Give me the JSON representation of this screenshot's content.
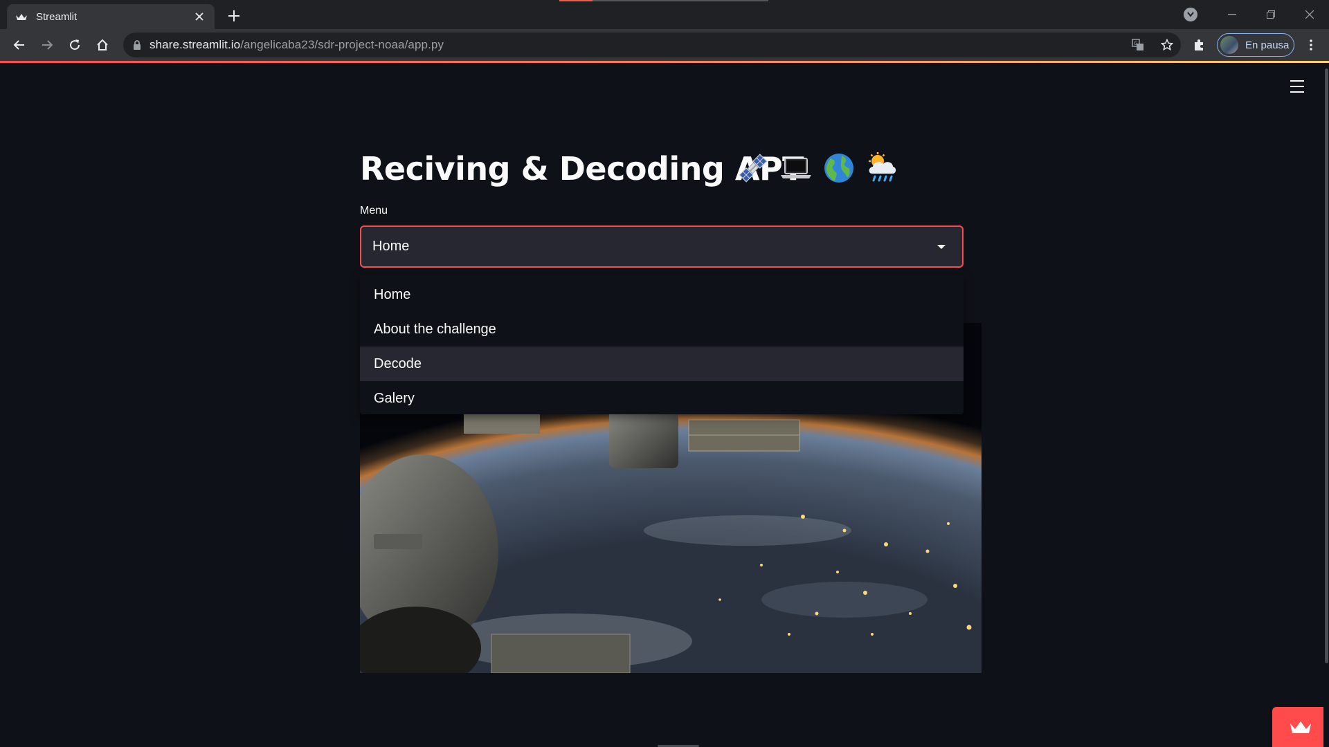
{
  "browser": {
    "tab_title": "Streamlit",
    "url_host": "share.streamlit.io",
    "url_path": "/angelicaba23/sdr-project-noaa/app.py",
    "profile_label": "En pausa",
    "load_progress": 0.16,
    "icons": [
      "streamlit-favicon-icon",
      "close-icon",
      "plus-icon",
      "back-icon",
      "forward-icon",
      "reload-icon",
      "home-icon",
      "lock-icon",
      "translate-icon",
      "star-icon",
      "extensions-icon",
      "kebab-icon",
      "tab-search-icon",
      "minimize-icon",
      "restore-icon",
      "window-close-icon"
    ]
  },
  "app": {
    "title": "Reciving & Decoding APT",
    "title_emojis": [
      "satellite-emoji",
      "laptop-emoji",
      "globe-emoji",
      "sun-rain-cloud-emoji"
    ],
    "menu_label": "Menu",
    "select": {
      "value": "Home",
      "options": [
        "Home",
        "About the challenge",
        "Decode",
        "Galery"
      ],
      "highlighted": "Decode"
    },
    "image_alt": "ISS view of Earth at night",
    "accent_color": "#ff4b4b",
    "background_color": "#0e1117"
  }
}
